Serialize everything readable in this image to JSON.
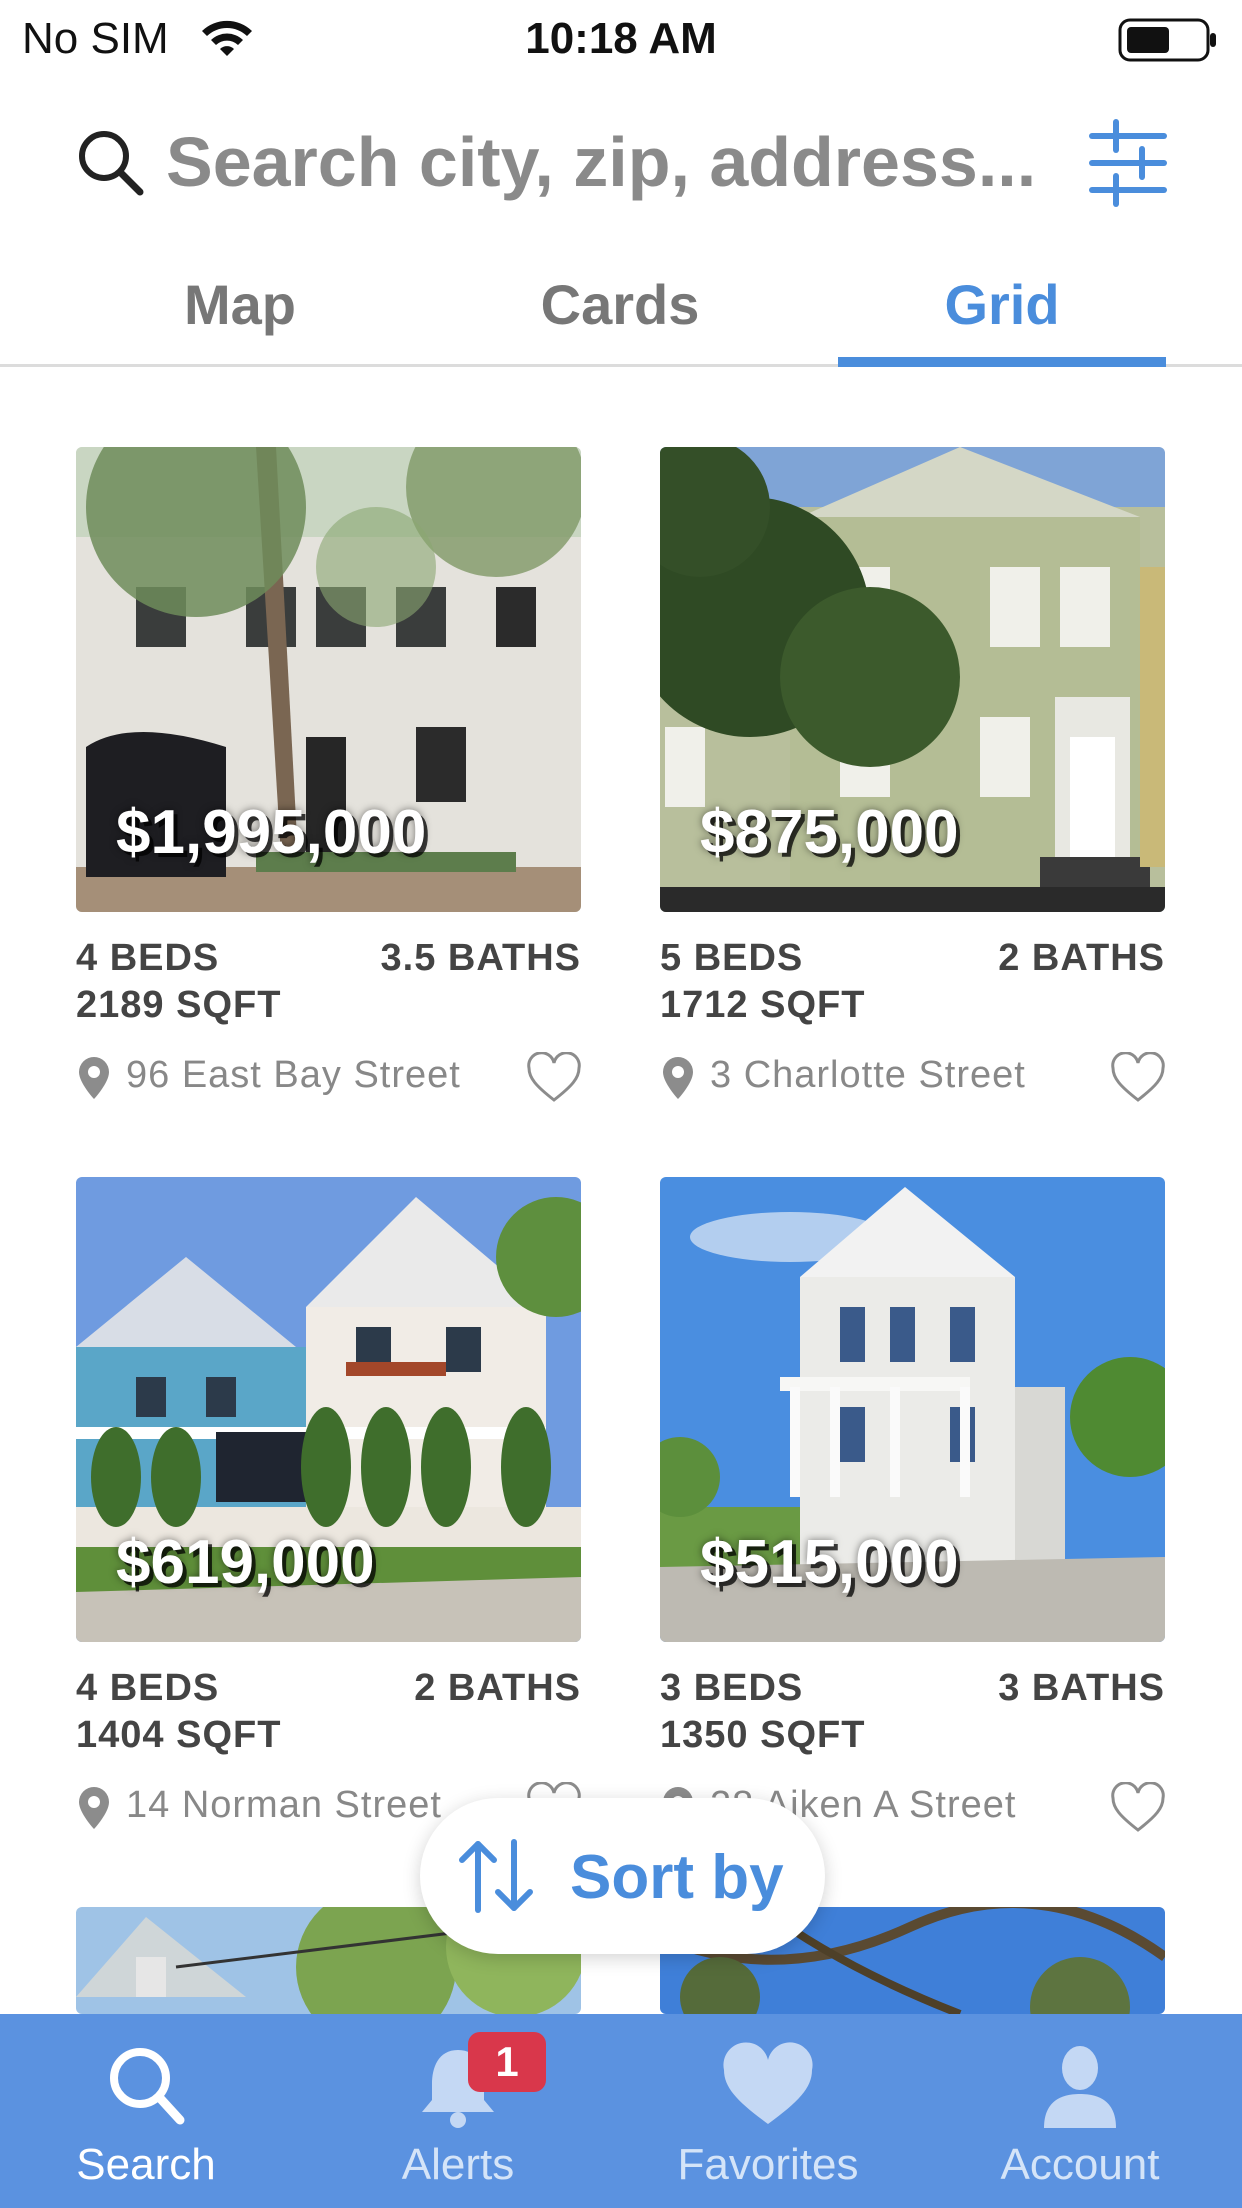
{
  "status_bar": {
    "carrier": "No SIM",
    "time": "10:18 AM"
  },
  "search": {
    "placeholder": "Search city, zip, address..."
  },
  "view_tabs": [
    {
      "label": "Map",
      "active": false
    },
    {
      "label": "Cards",
      "active": false
    },
    {
      "label": "Grid",
      "active": true
    }
  ],
  "listings": [
    {
      "price": "$1,995,000",
      "beds": "4 BEDS",
      "baths": "3.5 BATHS",
      "sqft": "2189 SQFT",
      "address": "96 East Bay Street",
      "favorited": false
    },
    {
      "price": "$875,000",
      "beds": "5 BEDS",
      "baths": "2 BATHS",
      "sqft": "1712 SQFT",
      "address": "3 Charlotte Street",
      "favorited": false
    },
    {
      "price": "$619,000",
      "beds": "4 BEDS",
      "baths": "2 BATHS",
      "sqft": "1404 SQFT",
      "address": "14 Norman Street",
      "favorited": false
    },
    {
      "price": "$515,000",
      "beds": "3 BEDS",
      "baths": "3 BATHS",
      "sqft": "1350 SQFT",
      "address": "28 Aiken A Street",
      "favorited": false
    }
  ],
  "sort": {
    "label": "Sort by"
  },
  "tab_bar": {
    "items": [
      {
        "label": "Search",
        "icon": "search-icon",
        "active": true
      },
      {
        "label": "Alerts",
        "icon": "bell-icon",
        "badge": "1"
      },
      {
        "label": "Favorites",
        "icon": "heart-icon"
      },
      {
        "label": "Account",
        "icon": "person-icon"
      }
    ]
  },
  "colors": {
    "accent": "#4a8ddc",
    "tab_bar": "#5b92e0",
    "badge": "#d9374b"
  }
}
